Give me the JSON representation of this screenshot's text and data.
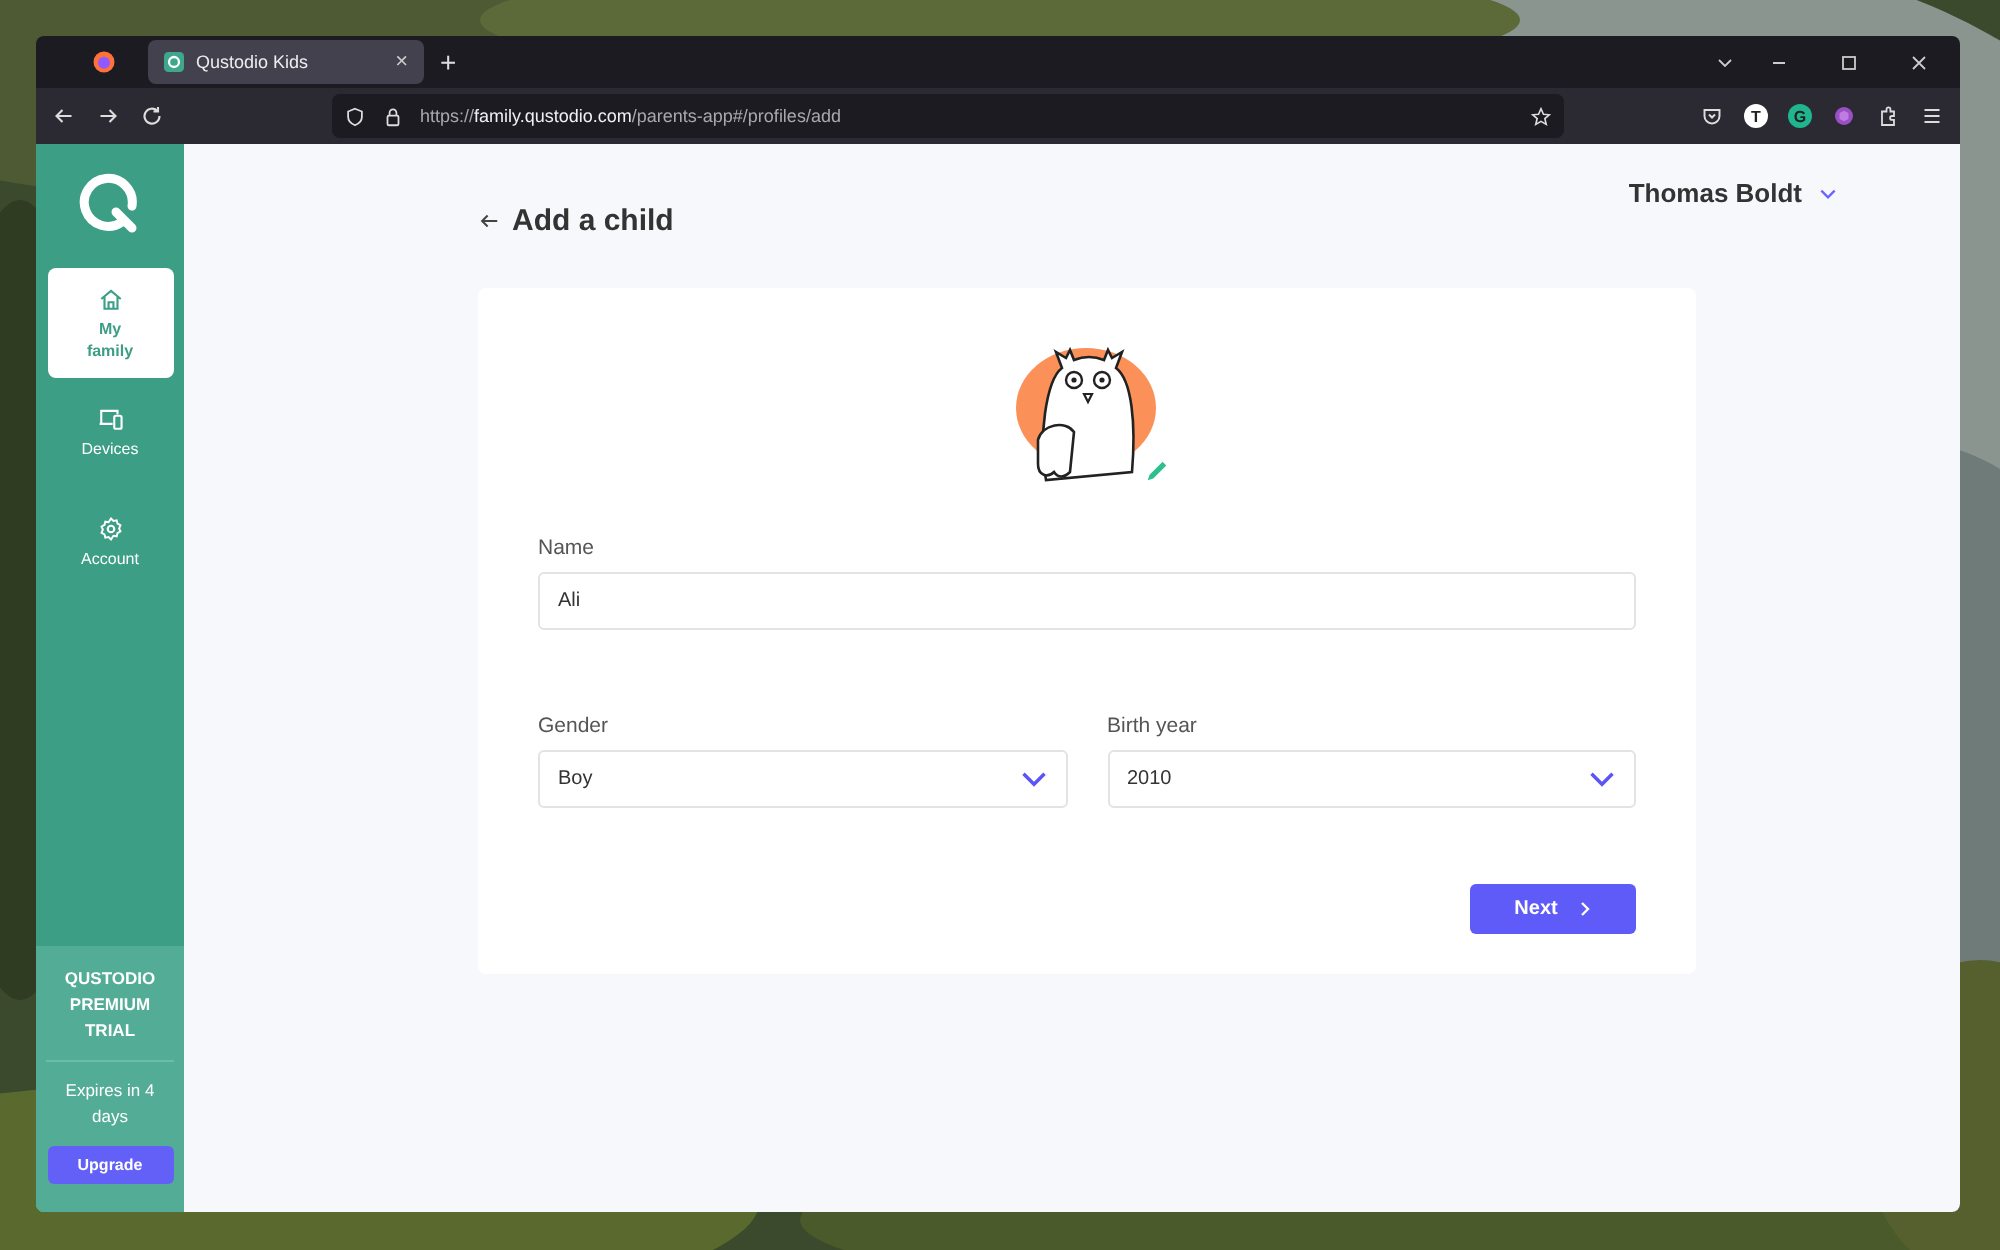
{
  "browser": {
    "tab": {
      "title": "Qustodio Kids",
      "close": "×",
      "selected": true
    },
    "new_tab": "+",
    "url": "https://**family.qustodio.com**/parents-app#/profiles/add",
    "extensions": [
      {
        "letter": "T",
        "color": "#ffffff"
      },
      {
        "letter": "G",
        "color": "#1fb58f"
      }
    ]
  },
  "sidebar": {
    "items": [
      {
        "label": "My family",
        "kind": "home",
        "selected": true
      },
      {
        "label": "Devices",
        "kind": "devices",
        "selected": false
      },
      {
        "label": "Account",
        "kind": "settings",
        "selected": false
      }
    ],
    "trial": {
      "title": "QUSTODIO PREMIUM TRIAL",
      "expires": "Expires in 4 days",
      "button": "Upgrade"
    }
  },
  "user_menu": {
    "name": "Thomas Boldt"
  },
  "page": {
    "title": "Add a child"
  },
  "form": {
    "name": {
      "label": "Name",
      "value": "Ali"
    },
    "gender": {
      "label": "Gender",
      "value": "Boy"
    },
    "birth_year": {
      "label": "Birth year",
      "value": "2010"
    },
    "next_button": "Next"
  }
}
